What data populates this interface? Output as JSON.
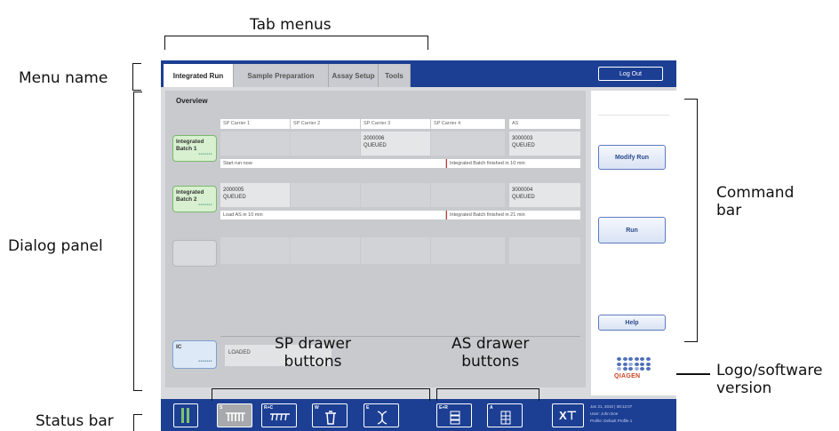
{
  "annotations": {
    "tab_menus": "Tab menus",
    "menu_name": "Menu name",
    "dialog_panel": "Dialog panel",
    "status_bar": "Status bar",
    "command_bar_1": "Command",
    "command_bar_2": "bar",
    "logo_software_1": "Logo/software",
    "logo_software_2": "version",
    "sp_drawer_1": "SP drawer",
    "sp_drawer_2": "buttons",
    "as_drawer_1": "AS drawer",
    "as_drawer_2": "buttons"
  },
  "menu": {
    "tabs": [
      "Integrated Run",
      "Sample Preparation",
      "Assay Setup",
      "Tools"
    ],
    "active_tab": "Integrated Run",
    "logout_label": "Log Out"
  },
  "dialog": {
    "title": "Overview",
    "columns": [
      "SP Carrier 1",
      "SP Carrier 2",
      "SP Carrier 3",
      "SP Carrier 4",
      "AS"
    ],
    "batches": [
      {
        "name_1": "Integrated",
        "name_2": "Batch 1",
        "stars": "•••••••",
        "cells": [
          "",
          "",
          "2000006\nQUEUED",
          "",
          "3000003\nQUEUED"
        ],
        "info_left": "Start run now",
        "info_right": "Integrated Batch finished in 10 min"
      },
      {
        "name_1": "Integrated",
        "name_2": "Batch 2",
        "stars": "•••••••",
        "cells": [
          "2000005\nQUEUED",
          "",
          "",
          "",
          "3000004\nQUEUED"
        ],
        "info_left": "Load AS in 10 min",
        "info_right": "Integrated Batch finished in 21 min"
      }
    ],
    "ic_label": "IC",
    "ic_stars": "•••••••",
    "ic_status": "LOADED"
  },
  "commands": {
    "modify_run": "Modify Run",
    "run": "Run",
    "help": "Help"
  },
  "logo_text": "QIAGEN",
  "statusbar": {
    "sp_buttons": [
      {
        "label": "S",
        "icon": "tube-rack-icon"
      },
      {
        "label": "R+C",
        "icon": "reagent-cartridge-icon"
      },
      {
        "label": "W",
        "icon": "waste-bin-icon"
      },
      {
        "label": "E",
        "icon": "eluate-rack-icon"
      }
    ],
    "as_buttons": [
      {
        "label": "E+R",
        "icon": "eluate-reagent-icon"
      },
      {
        "label": "A",
        "icon": "assay-plate-icon"
      }
    ],
    "info_line_1": "Jan 21, 2010 | 08:12:07",
    "info_line_2": "User:      John Doe",
    "info_line_3": "Profile:   Default Profile 1"
  },
  "colors": {
    "accent": "#1c3f94",
    "batch_ready": "#d8f0d0",
    "ic_box": "#dde9f7",
    "warning_line": "#cc3333"
  }
}
